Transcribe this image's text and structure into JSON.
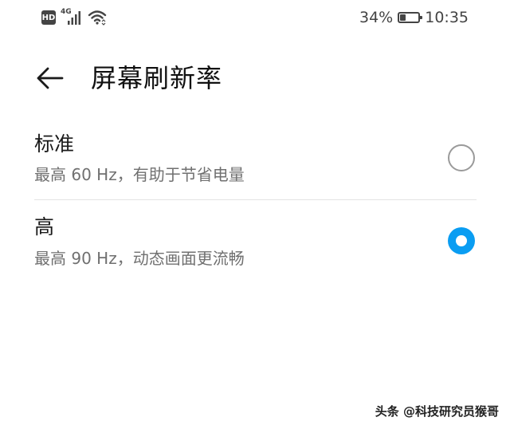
{
  "status_bar": {
    "hd_label": "HD",
    "network_label": "4G",
    "battery_text": "34%",
    "battery_level": 0.34,
    "time": "10:35"
  },
  "header": {
    "back_icon": "arrow-left-icon",
    "title": "屏幕刷新率"
  },
  "options": [
    {
      "title": "标准",
      "subtitle": "最高 60 Hz，有助于节省电量",
      "selected": false
    },
    {
      "title": "高",
      "subtitle": "最高 90 Hz，动态画面更流畅",
      "selected": true
    }
  ],
  "colors": {
    "accent": "#0a9df2",
    "radio_off": "#9a9a9a",
    "subtitle": "#707070"
  },
  "watermark": "头条 @科技研究员猴哥"
}
